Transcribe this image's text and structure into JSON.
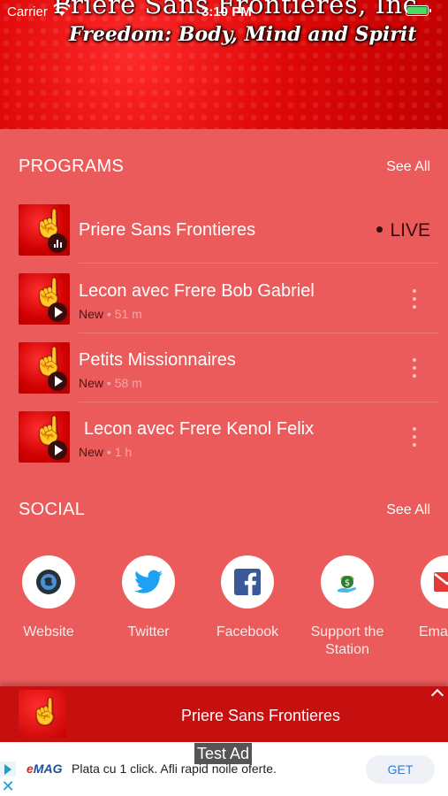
{
  "status_bar": {
    "carrier": "Carrier",
    "time": "3:10 PM"
  },
  "banner": {
    "title": "Priere Sans Frontieres, Inc.",
    "tagline": "Freedom: Body, Mind and Spirit"
  },
  "programs": {
    "heading": "PROGRAMS",
    "see_all": "See All",
    "items": [
      {
        "title": "Priere Sans Frontieres",
        "live": "LIVE"
      },
      {
        "title": "Lecon avec Frere Bob Gabriel",
        "status": "New",
        "duration": "51 m"
      },
      {
        "title": "Petits Missionnaires",
        "status": "New",
        "duration": "58 m"
      },
      {
        "title": "Lecon avec Frere Kenol Felix",
        "status": "New",
        "duration": "1 h"
      }
    ]
  },
  "social": {
    "heading": "SOCIAL",
    "see_all": "See All",
    "items": [
      {
        "label": "Website",
        "icon": "globe-icon"
      },
      {
        "label": "Twitter",
        "icon": "twitter-icon"
      },
      {
        "label": "Facebook",
        "icon": "facebook-icon"
      },
      {
        "label": "Support the Station",
        "icon": "donate-icon"
      },
      {
        "label": "Email",
        "icon": "email-icon"
      }
    ]
  },
  "player": {
    "title": "Priere Sans Frontieres"
  },
  "ad": {
    "tag": "Test Ad",
    "brand_e": "e",
    "brand_rest": "MAG",
    "text": "Plata cu 1 click. Afli rapid noile oferte.",
    "cta": "GET"
  },
  "colors": {
    "background": "#ec5b5b",
    "header": "#e00808",
    "player": "#c60f0f"
  }
}
